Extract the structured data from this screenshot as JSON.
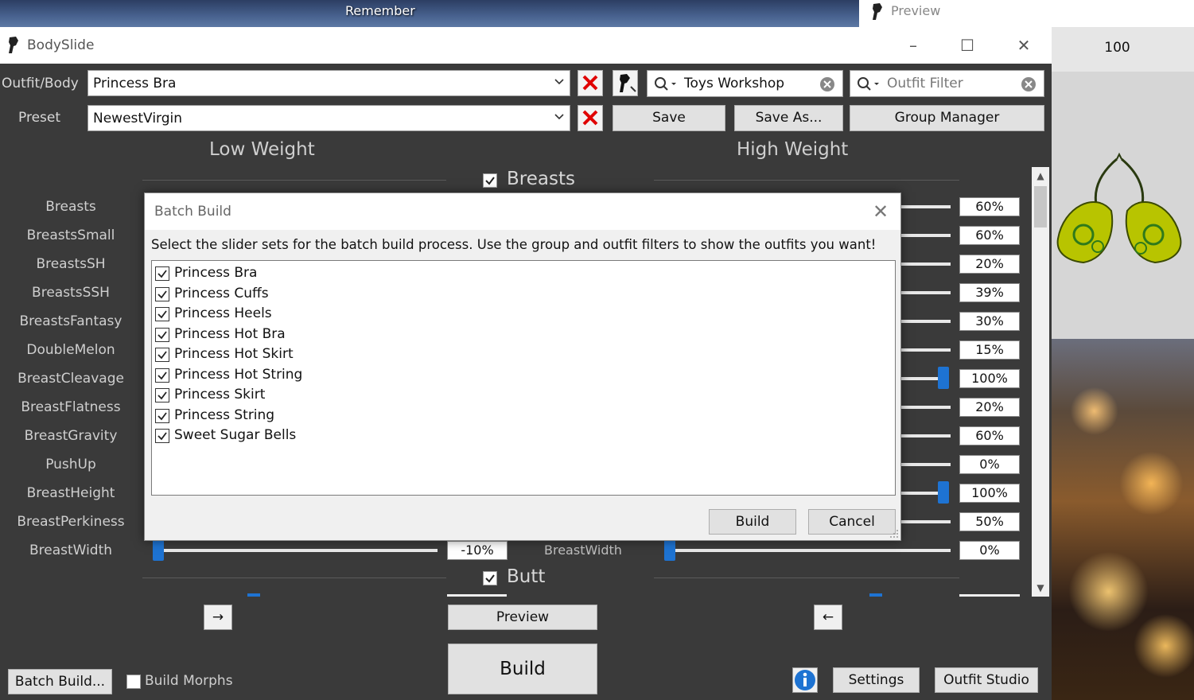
{
  "desktop": {
    "remember": "Remember"
  },
  "preview_window": {
    "title": "Preview",
    "zoom": "100"
  },
  "window": {
    "title": "BodySlide",
    "minimize": "–",
    "maximize": "☐",
    "close": "✕"
  },
  "toolbar": {
    "outfit_label": "Outfit/Body",
    "outfit_value": "Princess Bra",
    "preset_label": "Preset",
    "preset_value": "NewestVirgin",
    "group_filter_value": "Toys Workshop",
    "outfit_filter_placeholder": "Outfit Filter",
    "save": "Save",
    "save_as": "Save As...",
    "group_manager": "Group Manager"
  },
  "columns": {
    "low": "Low Weight",
    "high": "High Weight"
  },
  "groups": {
    "breasts": "Breasts",
    "butt": "Butt"
  },
  "sliders": [
    {
      "name": "Breasts",
      "high": "60%"
    },
    {
      "name": "BreastsSmall",
      "high": "60%"
    },
    {
      "name": "BreastsSH",
      "high": "20%"
    },
    {
      "name": "BreastsSSH",
      "high": "39%"
    },
    {
      "name": "BreastsFantasy",
      "high": "30%"
    },
    {
      "name": "DoubleMelon",
      "high": "15%"
    },
    {
      "name": "BreastCleavage",
      "high": "100%"
    },
    {
      "name": "BreastFlatness",
      "high": "20%"
    },
    {
      "name": "BreastGravity",
      "high": "60%"
    },
    {
      "name": "PushUp",
      "high": "0%"
    },
    {
      "name": "BreastHeight",
      "high": "100%"
    },
    {
      "name": "BreastPerkiness",
      "high": "50%"
    },
    {
      "name": "BreastWidth",
      "low": "-10%",
      "high": "0%",
      "center_label": "BreastWidth"
    }
  ],
  "dialog": {
    "title": "Batch Build",
    "instructions": "Select the slider sets for the batch build process. Use the group and outfit filters to show the outfits you want!",
    "items": [
      "Princess Bra",
      "Princess Cuffs",
      "Princess Heels",
      "Princess Hot Bra",
      "Princess Hot Skirt",
      "Princess Hot String",
      "Princess Skirt",
      "Princess String",
      "Sweet Sugar Bells"
    ],
    "build": "Build",
    "cancel": "Cancel"
  },
  "bottom": {
    "arrow_right": "→",
    "arrow_left": "←",
    "preview": "Preview",
    "build": "Build",
    "batch_build": "Batch Build...",
    "build_morphs": "Build Morphs",
    "settings": "Settings",
    "outfit_studio": "Outfit Studio"
  },
  "colors": {
    "accent": "#1e73d2",
    "background": "#3a3a3a",
    "delete": "#e00000"
  }
}
